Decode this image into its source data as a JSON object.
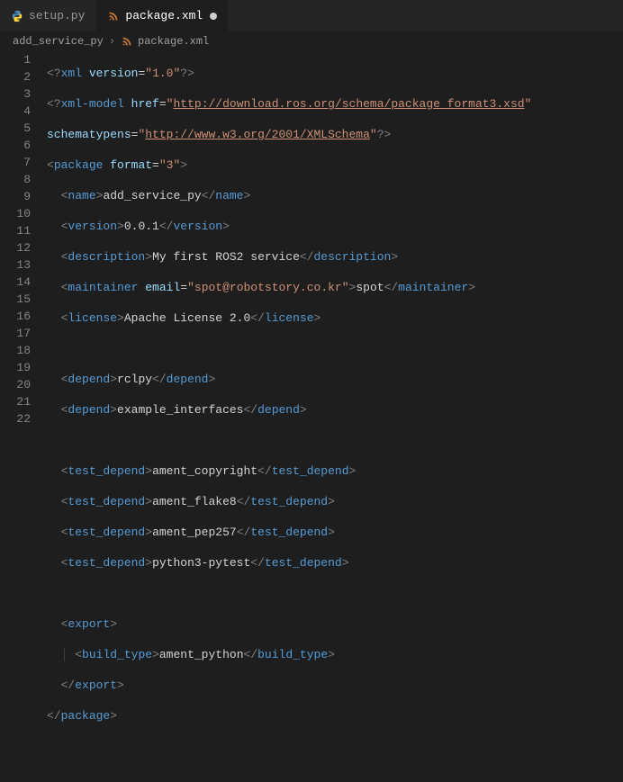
{
  "tabs": [
    {
      "label": "setup.py",
      "icon": "python",
      "active": false,
      "dirty": false
    },
    {
      "label": "package.xml",
      "icon": "rss",
      "active": true,
      "dirty": true
    }
  ],
  "breadcrumbs": {
    "folder": "add_service_py",
    "file": "package.xml",
    "file_icon": "rss"
  },
  "line_count": 22,
  "code": {
    "pkg_name": "add_service_py",
    "version": "0.0.1",
    "description": "My first ROS2 service",
    "maintainer_email": "spot@robotstory.co.kr",
    "maintainer_name": "spot",
    "license": "Apache License 2.0",
    "depends": [
      "rclpy",
      "example_interfaces"
    ],
    "test_depends": [
      "ament_copyright",
      "ament_flake8",
      "ament_pep257",
      "python3-pytest"
    ],
    "build_type": "ament_python",
    "schema_url": "http://download.ros.org/schema/package_format3.xsd",
    "schematypens_url": "http://www.w3.org/2001/XMLSchema",
    "xml_version": "1.0",
    "pkg_format": "3"
  }
}
